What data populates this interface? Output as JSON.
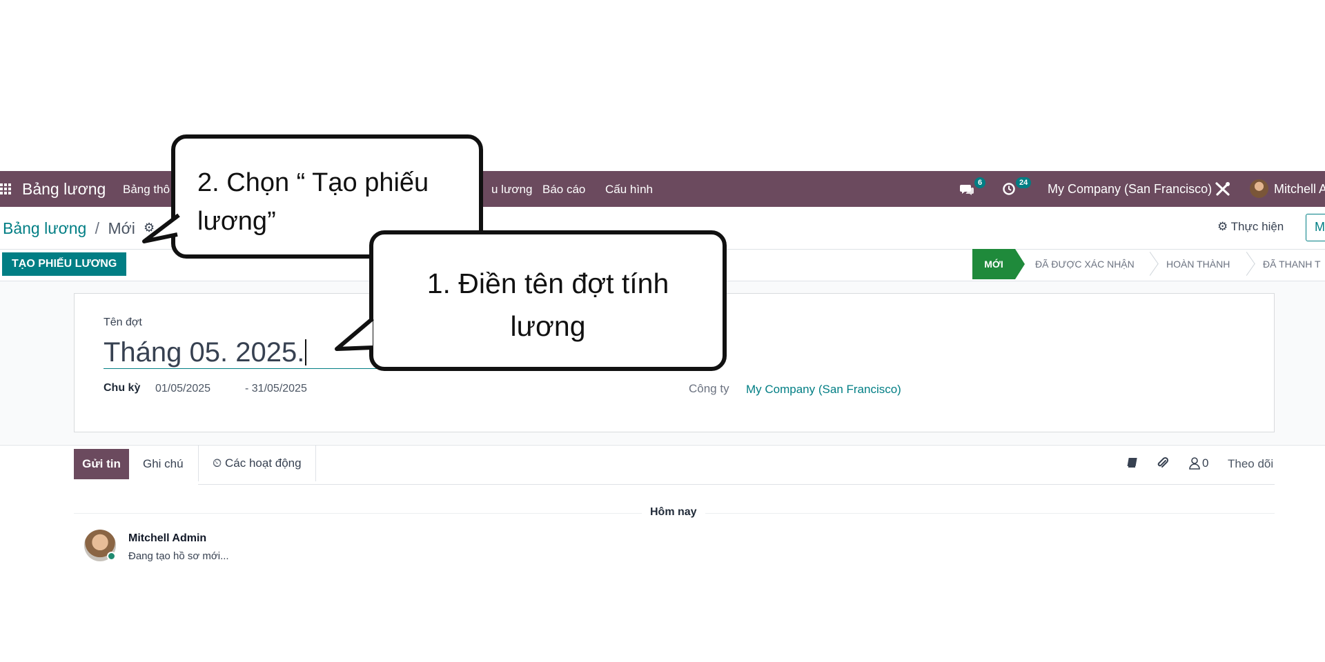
{
  "navbar": {
    "app_name": "Bảng lương",
    "menu": [
      "Bảng thô",
      "u lương",
      "Báo cáo",
      "Cấu hình"
    ],
    "messages_count": "6",
    "activities_count": "24",
    "company": "My Company (San Francisco)",
    "user": "Mitchell A"
  },
  "control_panel": {
    "breadcrumb_parent": "Bảng lương",
    "breadcrumb_separator": "/",
    "breadcrumb_current": "Mới",
    "action_label": "Thực hiện",
    "edge_button_label": "M"
  },
  "statusbar": {
    "primary_button": "TẠO PHIẾU LƯƠNG",
    "stages": [
      "MỚI",
      "ĐÃ ĐƯỢC XÁC NHẬN",
      "HOÀN THÀNH",
      "ĐÃ THANH T"
    ],
    "active_stage_index": 0
  },
  "form": {
    "name_label": "Tên đợt",
    "name_value": "Tháng 05. 2025.",
    "period_label": "Chu kỳ",
    "period_from": "01/05/2025",
    "period_to": "- 31/05/2025",
    "company_label": "Công ty",
    "company_value": "My Company (San Francisco)"
  },
  "chatter": {
    "send_message": "Gửi tin",
    "log_note": "Ghi chú",
    "activities": "Các hoạt động",
    "followers_count": "0",
    "follow": "Theo dõi",
    "today": "Hôm nay",
    "message": {
      "author": "Mitchell Admin",
      "body": "Đang tạo hồ sơ mới..."
    }
  },
  "callouts": {
    "step2_line1": "2. Chọn “ Tạo phiếu",
    "step2_line2": "lương”",
    "step1_line1": "1.   Điền tên đợt tính",
    "step1_line2": "lương"
  },
  "colors": {
    "navbar": "#6b4a5e",
    "accent": "#017e84",
    "active_stage": "#1f8a3b"
  }
}
